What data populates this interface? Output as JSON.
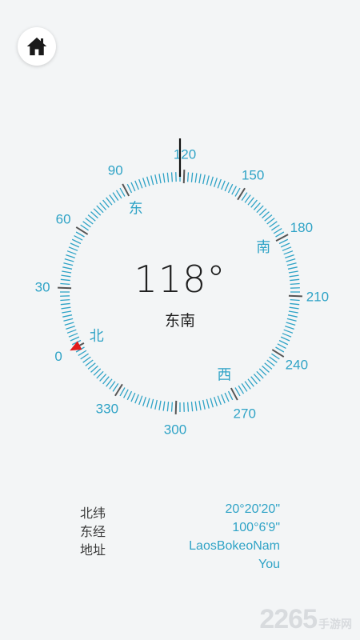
{
  "home_button": {
    "icon": "home-icon"
  },
  "compass": {
    "heading_value": 118,
    "heading_text": "118°",
    "direction_text": "东南",
    "degree_labels": [
      "0",
      "30",
      "60",
      "90",
      "120",
      "150",
      "180",
      "210",
      "240",
      "270",
      "300",
      "330"
    ],
    "cardinal_labels": {
      "north": "北",
      "east": "东",
      "south": "南",
      "west": "西"
    },
    "north_marker_icon": "red-triangle-pointer-icon",
    "colors": {
      "accent": "#2fa3c6",
      "major_tick": "#555555",
      "marker": "#e01b1b",
      "text": "#1f1f1f"
    }
  },
  "info": {
    "latitude_label": "北纬",
    "latitude_value": "20°20'20\"",
    "longitude_label": "东经",
    "longitude_value": "100°6'9\"",
    "address_label": "地址",
    "address_value_line1": "LaosBokeoNam",
    "address_value_line2": "You"
  },
  "watermark": {
    "text": "2265",
    "suffix": "手游网"
  }
}
